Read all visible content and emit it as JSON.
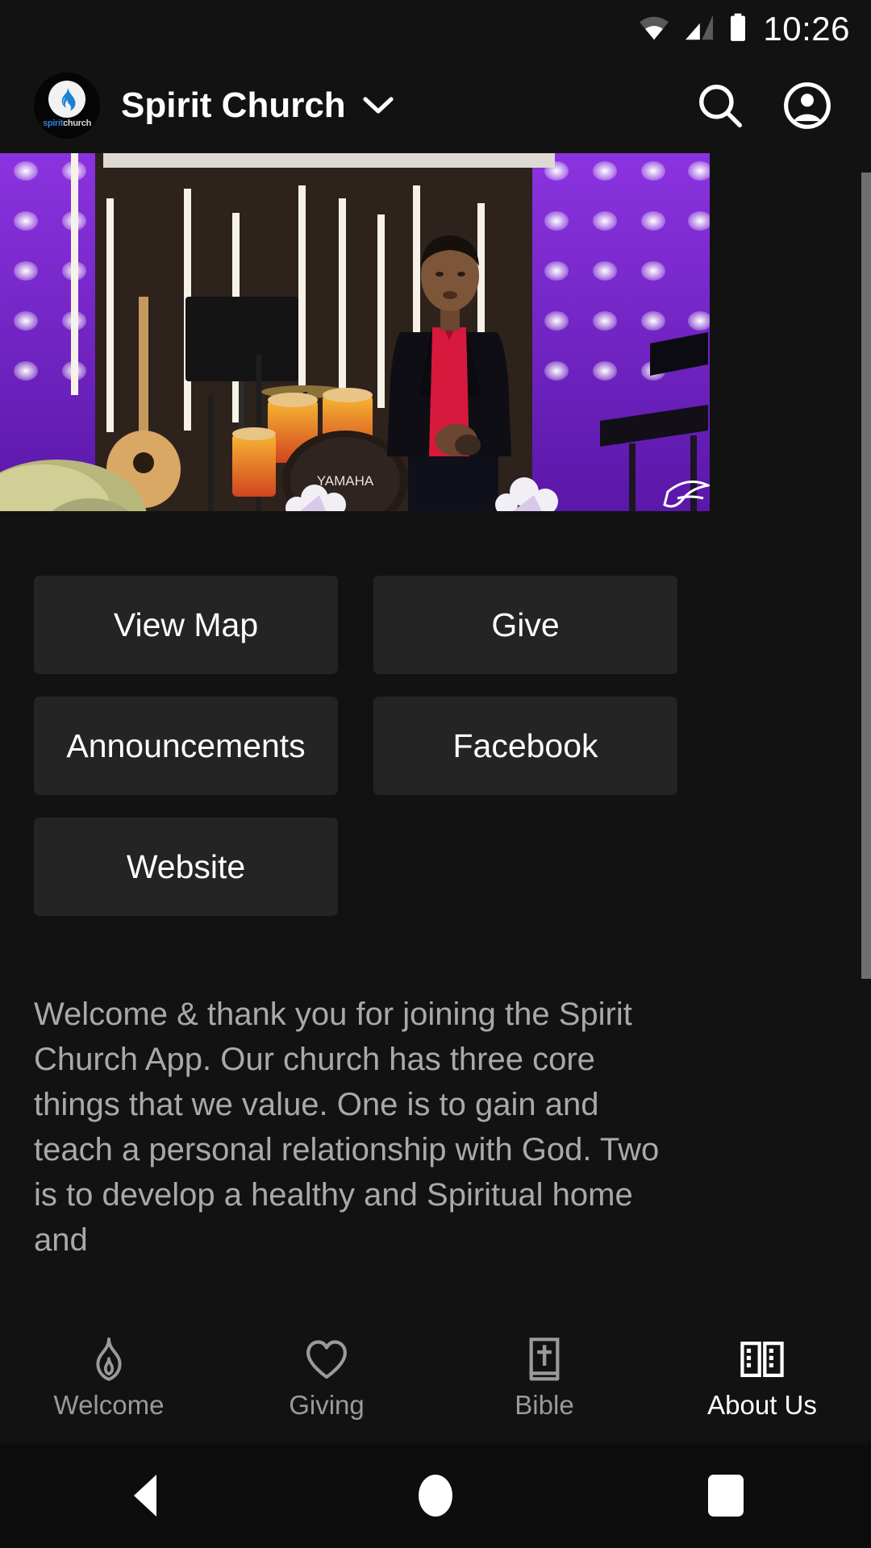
{
  "status_bar": {
    "time": "10:26",
    "icons": [
      "wifi-icon",
      "cellular-signal-icon",
      "battery-icon"
    ]
  },
  "header": {
    "logo_text_blue": "spirit",
    "logo_text_gray": "church",
    "title": "Spirit Church",
    "dropdown_icon": "chevron-down-icon",
    "search_icon": "search-icon",
    "profile_icon": "account-circle-icon"
  },
  "hero": {
    "alt": "Church stage with speaker in red shirt, drum kit, guitar and purple LED light wall"
  },
  "buttons": [
    {
      "label": "View Map",
      "name": "view-map-button"
    },
    {
      "label": "Give",
      "name": "give-button"
    },
    {
      "label": "Announcements",
      "name": "announcements-button"
    },
    {
      "label": "Facebook",
      "name": "facebook-button"
    },
    {
      "label": "Website",
      "name": "website-button"
    }
  ],
  "welcome": {
    "text": "Welcome & thank you for joining the Spirit Church App. Our church has three core things that we value. One is to gain and teach a personal relationship with God. Two is to develop a healthy and Spiritual home and"
  },
  "tabs": [
    {
      "label": "Welcome",
      "icon": "flame-icon",
      "active": false
    },
    {
      "label": "Giving",
      "icon": "heart-icon",
      "active": false
    },
    {
      "label": "Bible",
      "icon": "bible-book-icon",
      "active": false
    },
    {
      "label": "About Us",
      "icon": "open-book-icon",
      "active": true
    }
  ],
  "android_nav": {
    "back": "back-triangle-icon",
    "home": "home-circle-icon",
    "recents": "recents-square-icon"
  },
  "colors": {
    "background": "#121212",
    "button_bg": "#242424",
    "text_primary": "#ffffff",
    "text_secondary": "#a9a9a9",
    "tab_inactive": "#9a9a9a",
    "logo_blue": "#2f7fd8",
    "scrollbar": "#6e7070"
  },
  "scrollbar": {
    "name": "vertical-scrollbar"
  }
}
